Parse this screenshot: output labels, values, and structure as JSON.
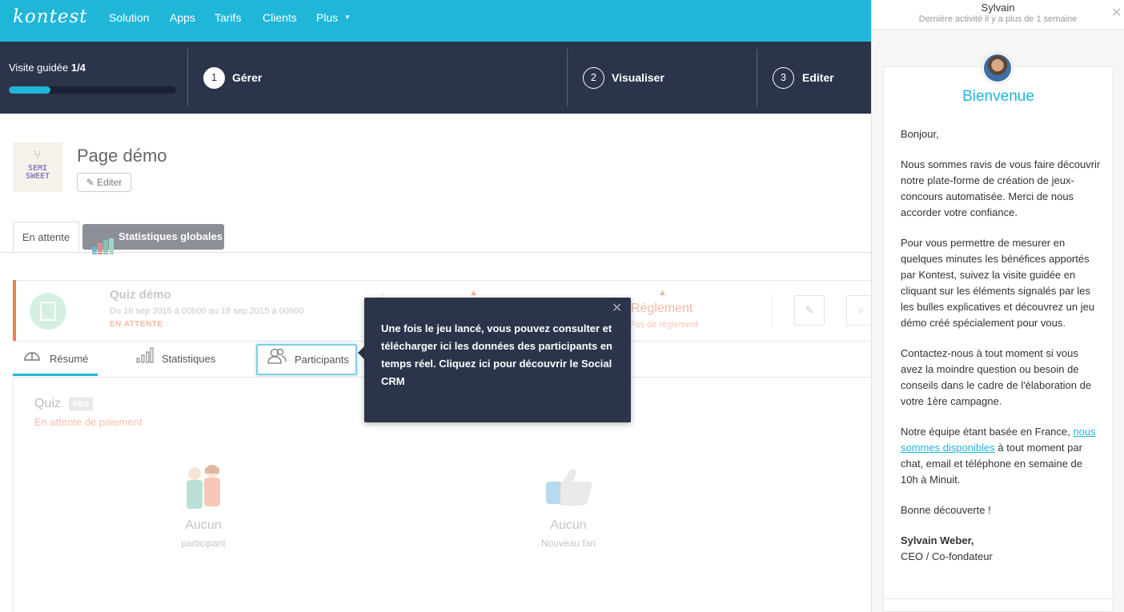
{
  "nav": {
    "logo": "kontest",
    "items": [
      "Solution",
      "Apps",
      "Tarifs",
      "Clients",
      "Plus"
    ]
  },
  "tour": {
    "label": "Visite guidée",
    "step_count": "1/4",
    "progress": 0.25,
    "steps": [
      {
        "number": "1",
        "label": "Gérer"
      },
      {
        "number": "2",
        "label": "Visualiser"
      },
      {
        "number": "3",
        "label": "Editer"
      }
    ]
  },
  "page": {
    "brand_logo_top": "SEMI",
    "brand_logo_bottom": "SWEET",
    "title": "Page démo",
    "edit_label": "Editer"
  },
  "page_tabs": {
    "waiting": "En attente",
    "stats": "Statistiques globales"
  },
  "contest": {
    "title": "Quiz démo",
    "dates": "Du 18 sep 2015 à 00h00 au 19 sep 2015 à 00h00",
    "status": "EN ATTENTE",
    "reglement_title": "Règlement",
    "reglement_sub": "Pas de règlement"
  },
  "sub_tabs": {
    "resume": "Résumé",
    "stats": "Statistiques",
    "participants": "Participants"
  },
  "panel": {
    "quiz_label": "Quiz",
    "pro_badge": "PRO",
    "quiz_status": "En attente de paiement",
    "stat1_value": "Aucun",
    "stat1_label": "participant",
    "stat2_value": "Aucun",
    "stat2_label": "Nouveau fan"
  },
  "tooltip": {
    "text": "Une fois le jeu lancé, vous pouvez consulter et télécharger ici les données des participants en temps réel. Cliquez ici pour découvrir le Social CRM"
  },
  "chat": {
    "name": "Sylvain",
    "activity": "Dernière activité il y a plus de 1 semaine",
    "welcome": "Bienvenue",
    "greeting": "Bonjour,",
    "p1": "Nous sommes ravis de vous faire découvrir notre plate-forme de création de jeux-concours automatisée. Merci de nous accorder votre confiance.",
    "p2": "Pour vous permettre de mesurer en quelques minutes les bénéfices apportés par Kontest, suivez la visite guidée en cliquant sur les éléments signalés par les les bulles explicatives et découvrez un jeu démo créé spécialement pour vous.",
    "p3": "Contactez-nous à tout moment si vous avez la moindre question ou besoin de conseils dans le cadre de l'élaboration de votre 1ère campagne.",
    "p4_before": "Notre équipe étant basée en France,",
    "p4_link": "nous sommes disponibles",
    "p4_after": "à tout moment par chat, email et téléphone en semaine de 10h à Minuit.",
    "closing": "Bonne découverte !",
    "signature_name": "Sylvain Weber,",
    "signature_title": "CEO / Co-fondateur"
  },
  "colors": {
    "brand": "#1fb6d8",
    "dark": "#2b344b",
    "accent": "#f07d52"
  }
}
